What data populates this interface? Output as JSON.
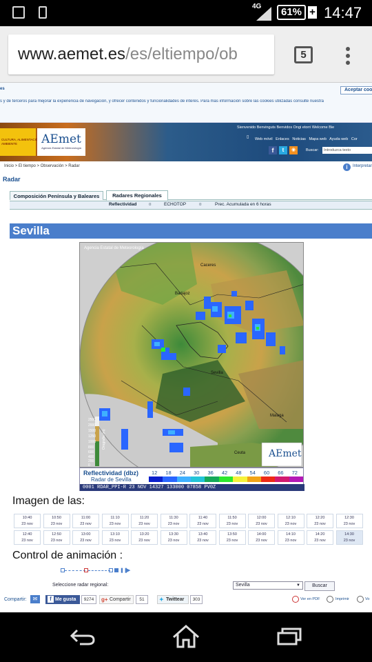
{
  "status_bar": {
    "network": "4G",
    "battery": "61%",
    "time": "14:47"
  },
  "browser": {
    "url_domain": "www.aemet.es",
    "url_path": "/es/eltiempo/ob",
    "tab_count": "5"
  },
  "cookie_notice": {
    "label": "es",
    "text": "s y de terceros para mejorar la experiencia de navegación, y ofrecer contenidos y funcionalidades de interés. Para más información sobre las cookies utilizadas consulte nuestra",
    "accept": "Aceptar coo"
  },
  "header": {
    "ministry": "CULTURA, ALIMENTACIÓN\nAMBIENTE",
    "logo": "AEmet",
    "logo_sub": "Agencia Estatal de Meteorología",
    "top_links": "Sienvenido  Benvinguts  Benvidos  Ongi etorri  Welcome  Bie",
    "links": [
      "Web móvil",
      "Enlaces",
      "Noticias",
      "Mapa web",
      "Ayuda web",
      "Cor"
    ],
    "search_label": "Buscar:",
    "search_placeholder": "Introduzca texto"
  },
  "breadcrumb": [
    "Inicio",
    "El tiempo",
    "Observación",
    "Radar"
  ],
  "interpret_link": "Interpretar",
  "section_title": "Radar",
  "tabs": [
    "Composición Península y Baleares",
    "Radares Regionales"
  ],
  "subtabs": [
    "Reflectividad",
    "ECHOTOP",
    "Prec. Acumulada en 6 horas"
  ],
  "region_title": "Sevilla",
  "radar": {
    "credit": "Agencia Estatal de Meteorología",
    "places": [
      "Caceres",
      "Badajoz",
      "Sevilla",
      "Malaga",
      "Ceuta"
    ],
    "orography_label": "Orografia (m)",
    "orography_ticks": [
      "2500",
      "2000",
      "1500",
      "1250",
      "1000",
      "800",
      "600",
      "400",
      "200",
      "0"
    ],
    "legend_title": "Reflectividad (dbz)",
    "legend_sub": "Radar de Sevilla",
    "legend_values": [
      "12",
      "18",
      "24",
      "30",
      "36",
      "42",
      "48",
      "54",
      "60",
      "66",
      "72"
    ],
    "legend_colors": [
      "#0a1fcc",
      "#2a66ff",
      "#3fb0ff",
      "#22c4d8",
      "#16a85a",
      "#2ee82e",
      "#f6f23a",
      "#f2a417",
      "#ee2a16",
      "#d21b70",
      "#b418b6"
    ],
    "footer_code": "0001 RDAR_PPI-R   23 NOV 14327 133000 07858 PV0Z"
  },
  "image_times_label": "Imagen de las:",
  "times_row1": [
    {
      "t": "10:40",
      "d": "23 nov"
    },
    {
      "t": "10:50",
      "d": "23 nov"
    },
    {
      "t": "11:00",
      "d": "23 nov"
    },
    {
      "t": "11:10",
      "d": "23 nov"
    },
    {
      "t": "11:20",
      "d": "23 nov"
    },
    {
      "t": "11:30",
      "d": "23 nov"
    },
    {
      "t": "11:40",
      "d": "23 nov"
    },
    {
      "t": "11:50",
      "d": "23 nov"
    },
    {
      "t": "12:00",
      "d": "23 nov"
    },
    {
      "t": "12:10",
      "d": "23 nov"
    },
    {
      "t": "12:20",
      "d": "23 nov"
    },
    {
      "t": "12:30",
      "d": "23 nov"
    }
  ],
  "times_row2": [
    {
      "t": "12:40",
      "d": "23 nov"
    },
    {
      "t": "12:50",
      "d": "23 nov"
    },
    {
      "t": "13:00",
      "d": "23 nov"
    },
    {
      "t": "13:10",
      "d": "23 nov"
    },
    {
      "t": "13:20",
      "d": "23 nov"
    },
    {
      "t": "13:30",
      "d": "23 nov"
    },
    {
      "t": "13:40",
      "d": "23 nov"
    },
    {
      "t": "13:50",
      "d": "23 nov"
    },
    {
      "t": "14:00",
      "d": "23 nov"
    },
    {
      "t": "14:10",
      "d": "23 nov"
    },
    {
      "t": "14:20",
      "d": "23 nov"
    },
    {
      "t": "14:30",
      "d": "23 nov"
    }
  ],
  "animation_label": "Control de animación :",
  "select_label": "Seleccione radar regional:",
  "select_value": "Sevilla",
  "search_button": "Buscar",
  "share": {
    "label": "Compartir:",
    "like": "Me gusta",
    "like_count": "9274",
    "gplus": "Compartir",
    "gplus_count": "51",
    "tweet": "Twittear",
    "tweet_count": "303"
  },
  "tools": [
    "Ver en PDF",
    "Imprimir",
    "Vo"
  ]
}
